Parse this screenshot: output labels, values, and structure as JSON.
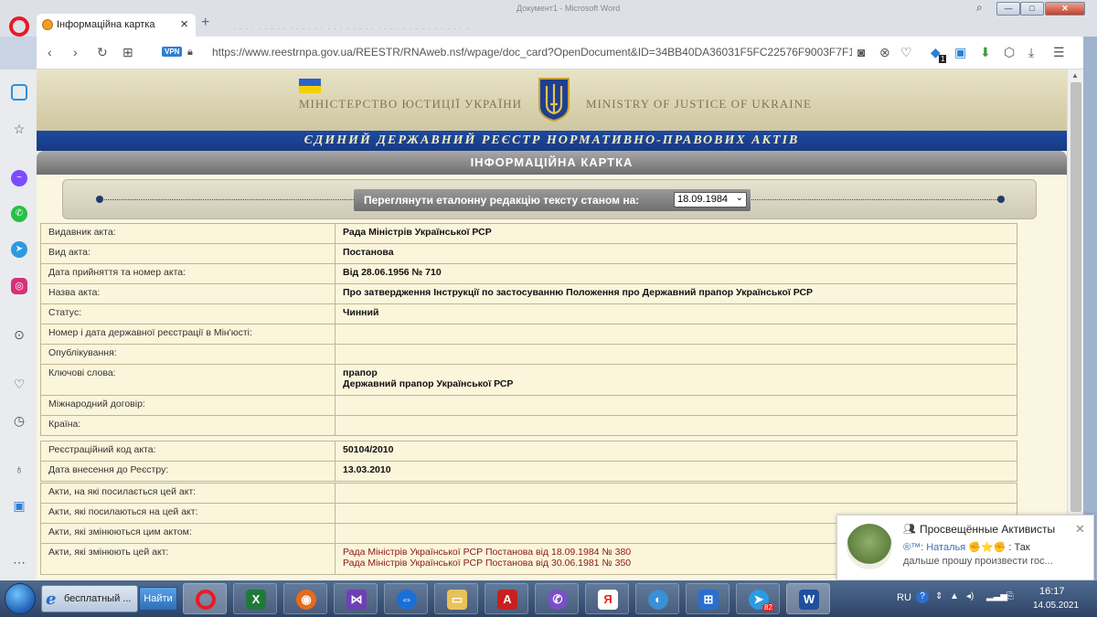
{
  "browser": {
    "tab_title": "Інформаційна картка",
    "url": "https://www.reestrnpa.gov.ua/REESTR/RNAweb.nsf/wpage/doc_card?OpenDocument&ID=34BB40DA36031F5FC22576F9003F7F1",
    "vpn_label": "VPN",
    "background_window_title": "Документ1 - Microsoft Word",
    "extension_badge": "1"
  },
  "header": {
    "ministry_ua": "МІНІСТЕРСТВО ЮСТИЦІЇ УКРАЇНИ",
    "ministry_en": "MINISTRY OF JUSTICE OF UKRAINE",
    "registry_title": "ЄДИНИЙ ДЕРЖАВНИЙ РЕЄСТР НОРМАТИВНО-ПРАВОВИХ АКТІВ",
    "card_title": "ІНФОРМАЦІЙНА КАРТКА"
  },
  "revision": {
    "label": "Переглянути еталонну редакцію тексту станом на:",
    "selected_date": "18.09.1984"
  },
  "card_rows": [
    {
      "key": "Видавник акта:",
      "value": "Рада Міністрів Української РСР"
    },
    {
      "key": "Вид акта:",
      "value": "Постанова"
    },
    {
      "key": "Дата прийняття та номер акта:",
      "value": "Від 28.06.1956 № 710"
    },
    {
      "key": "Назва акта:",
      "value": "Про затвердження Інструкції по застосуванню Положення про Державний прапор Української РСР"
    },
    {
      "key": "Статус:",
      "value": "Чинний"
    },
    {
      "key": "Номер і дата державної реєстрації в Мін'юсті:",
      "value": ""
    },
    {
      "key": "Опублікування:",
      "value": ""
    },
    {
      "key": "Ключові слова:",
      "value": "прапор",
      "value2": "Державний прапор Української РСР"
    },
    {
      "key": "Міжнародний договір:",
      "value": ""
    },
    {
      "key": "Країна:",
      "value": ""
    }
  ],
  "registry_rows": [
    {
      "key": "Реєстраційний код акта:",
      "value": "50104/2010"
    },
    {
      "key": "Дата внесення до Реєстру:",
      "value": "13.03.2010"
    }
  ],
  "relation_rows": [
    {
      "key": "Акти, на які посилається цей акт:",
      "value": ""
    },
    {
      "key": "Акти, які посилаються на цей акт:",
      "value": ""
    },
    {
      "key": "Акти, які змінюються цим актом:",
      "value": ""
    },
    {
      "key": "Акти, які змінюють цей акт:",
      "value": "Рада Міністрів Української РСР Постанова від 18.09.1984 № 380",
      "value2": "Рада Міністрів Української РСР Постанова від 30.06.1981 № 350"
    }
  ],
  "notification": {
    "group_name": "Просвещённые Активисты",
    "sender": "®™: Наталья",
    "message_line1": ": Так",
    "message_line2": "дальше прошу произвести гос..."
  },
  "taskbar": {
    "search_text": "бесплатный ...",
    "go_label": "Найти",
    "lang": "RU",
    "time": "16:17",
    "date": "14.05.2021",
    "telegram_badge": "82"
  },
  "icons": {
    "flag_colors": [
      "#2a64c8",
      "#f5d000"
    ],
    "accent_blue": "#1d4aa0",
    "link_red": "#8b1818"
  }
}
